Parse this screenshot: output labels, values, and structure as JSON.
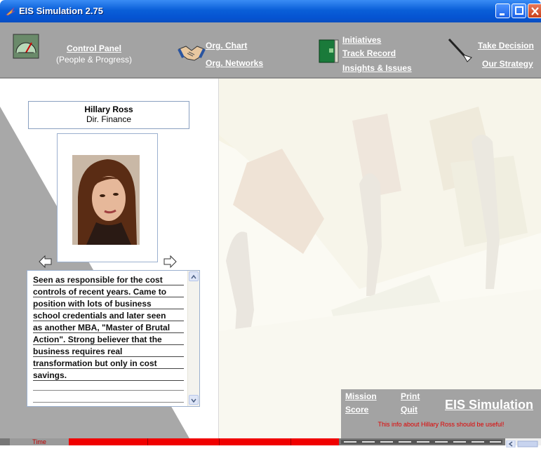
{
  "window": {
    "title": "EIS Simulation 2.75",
    "icon": "eis-app-icon",
    "buttons": [
      "minimize",
      "maximize",
      "close"
    ]
  },
  "toolbar": {
    "control_panel": "Control Panel",
    "control_panel_sub": "(People & Progress)",
    "org_chart": "Org. Chart",
    "org_networks": "Org. Networks",
    "initiatives": "Initiatives",
    "track_record": "Track Record",
    "insights_issues": "Insights & Issues",
    "take_decision": "Take Decision",
    "our_strategy": "Our Strategy",
    "icons": [
      "gauge-icon",
      "handshake-icon",
      "book-icon",
      "pointer-icon"
    ]
  },
  "person": {
    "name": "Hillary Ross",
    "role": "Dir. Finance",
    "bio_lines": [
      "Seen as responsible for the cost",
      "controls of recent years. Came to",
      "position with lots of business",
      "school credentials and later seen",
      "as another MBA, \"Master of Brutal",
      "Action\". Strong believer that the",
      "business requires real",
      "transformation but only in cost",
      "savings."
    ]
  },
  "info_panel": {
    "mission": "Mission",
    "score": "Score",
    "print": "Print",
    "quit": "Quit",
    "brand": "EIS Simulation",
    "message": "This info about Hillary Ross should be useful!"
  },
  "status": {
    "time_label": "Time"
  },
  "colors": {
    "toolbar_bg": "#a3a3a3",
    "titlebar": "#0a5fd8",
    "time_bar": "#f00000",
    "message": "#e00000"
  }
}
